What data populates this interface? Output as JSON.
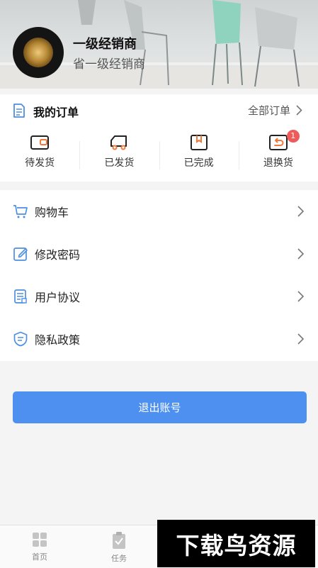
{
  "profile": {
    "name": "一级经销商",
    "level": "省一级经销商"
  },
  "orders": {
    "title": "我的订单",
    "all_label": "全部订单",
    "statuses": [
      {
        "label": "待发货",
        "icon": "wallet-icon"
      },
      {
        "label": "已发货",
        "icon": "truck-icon"
      },
      {
        "label": "已完成",
        "icon": "box-icon"
      },
      {
        "label": "退换货",
        "icon": "return-icon",
        "badge": "1"
      }
    ]
  },
  "menu": {
    "items": [
      {
        "label": "购物车",
        "icon": "cart-icon"
      },
      {
        "label": "修改密码",
        "icon": "edit-icon"
      },
      {
        "label": "用户协议",
        "icon": "agreement-icon"
      },
      {
        "label": "隐私政策",
        "icon": "shield-icon"
      }
    ]
  },
  "logout_label": "退出账号",
  "tabbar": {
    "tabs": [
      {
        "label": "首页",
        "icon": "home-grid-icon"
      },
      {
        "label": "任务",
        "icon": "clipboard-icon"
      }
    ]
  },
  "watermark": "下载鸟资源",
  "colors": {
    "primary": "#4d90f0",
    "badge": "#ef5b5b",
    "icon": "#4d8fe0"
  }
}
